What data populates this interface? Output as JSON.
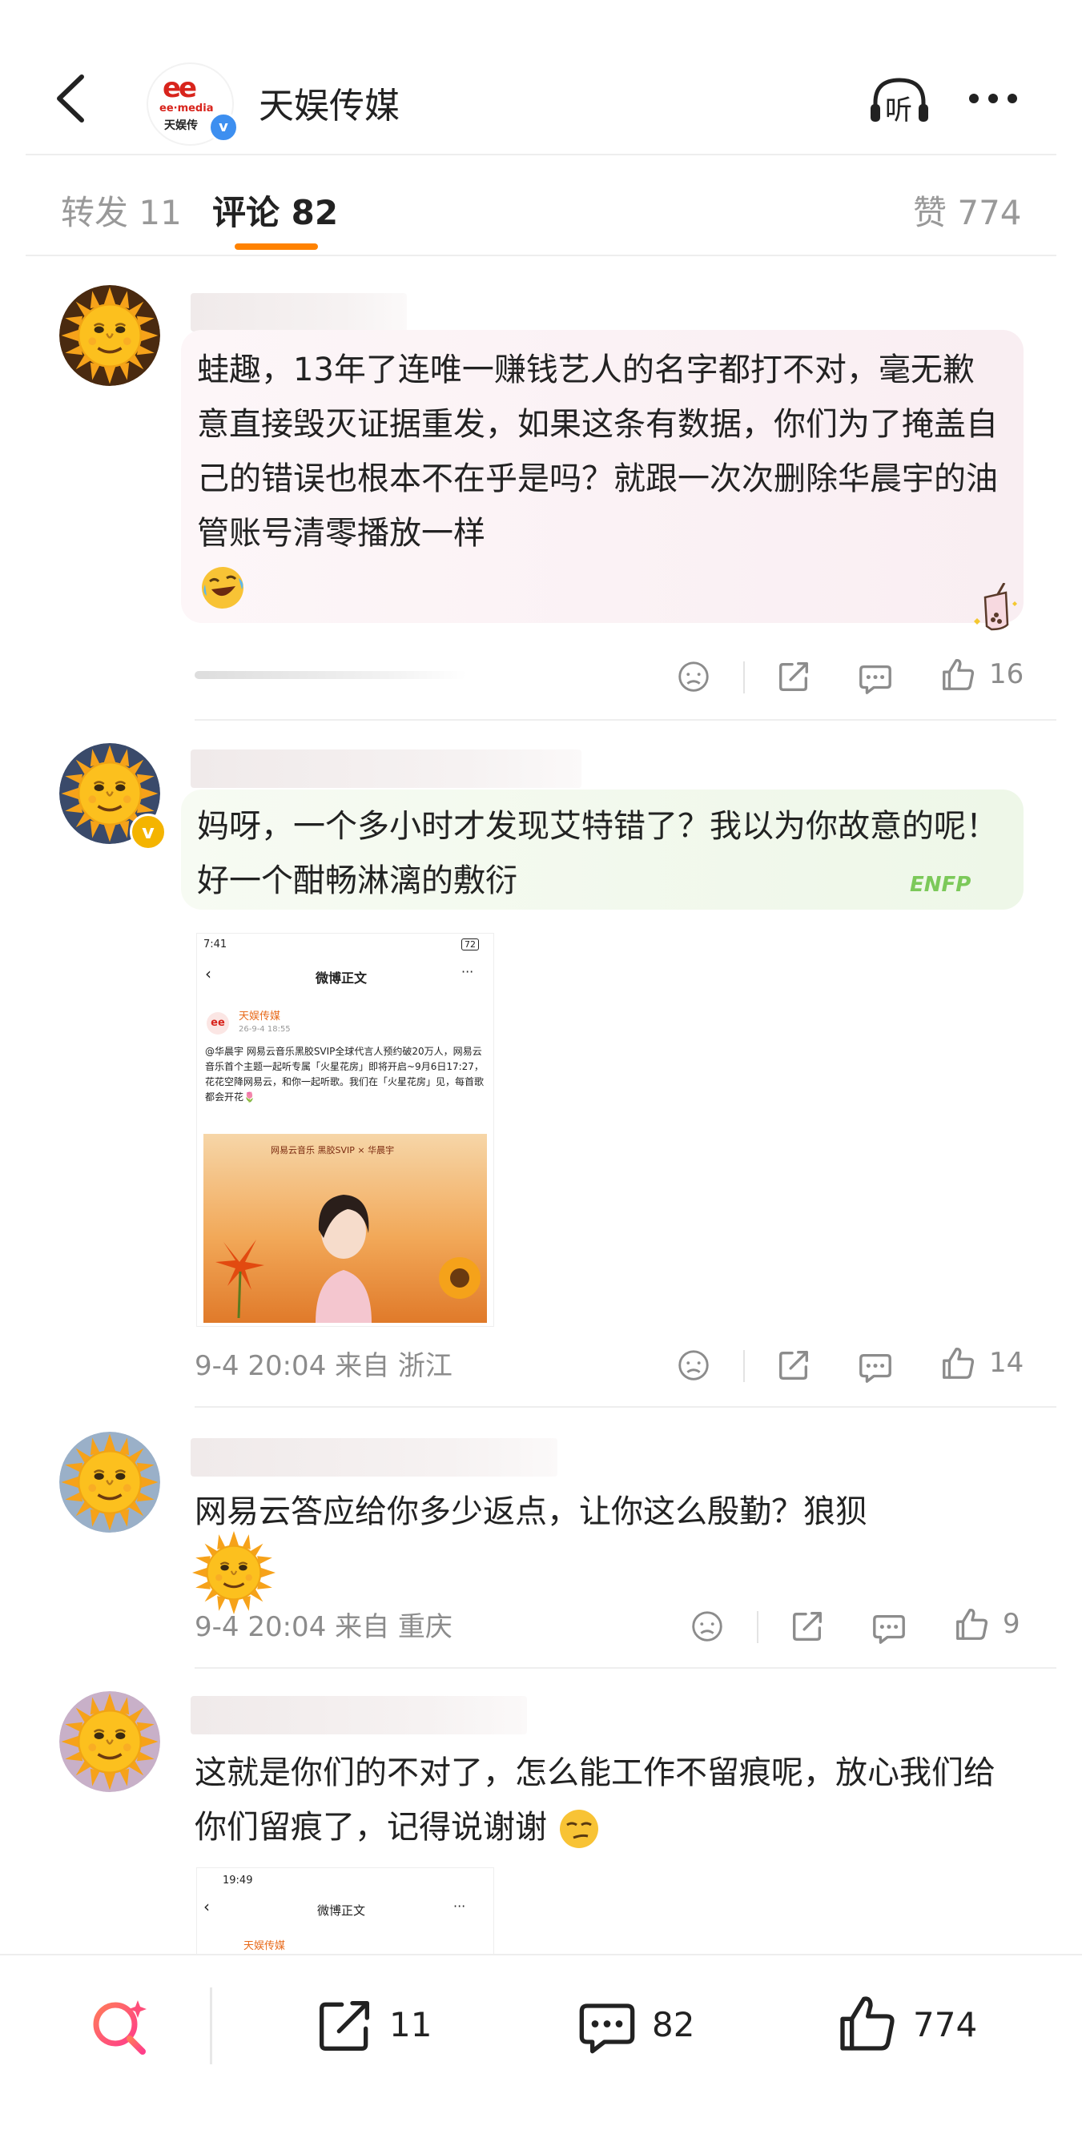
{
  "header": {
    "account_name": "天娱传媒",
    "logo_text": "ee",
    "logo_sub": "ee·media",
    "logo_cn": "天娱传",
    "listen_label": "听",
    "verified_mark": "v"
  },
  "tabs": {
    "repost": "转发 11",
    "comments": "评论 82",
    "likes": "赞 774"
  },
  "comments": [
    {
      "text": "蛙趣，13年了连唯一赚钱艺人的名字都打不对，毫无歉意直接毁灭证据重发，如果这条有数据，你们为了掩盖自己的错误也根本不在乎是吗？就跟一次次删除华晨宇的油管账号清零播放一样",
      "meta": "",
      "likes": "16"
    },
    {
      "text": "妈呀，一个多小时才发现艾特错了？我以为你故意的呢！好一个酣畅淋漓的敷衍",
      "meta": "9-4 20:04  来自 浙江",
      "likes": "14",
      "bubble_tag": "ENFP",
      "shot": {
        "time": "7:41",
        "battery": "72",
        "title": "微博正文",
        "account": "天娱传媒",
        "date": "26-9-4 18:55",
        "body": "@华晨宇 网易云音乐黑胶SVIP全球代言人预约破20万人，网易云音乐首个主题一起听专属「火星花房」即将开启~9月6日17:27，花花空降网易云，和你一起听歌。我们在「火星花房」见，每首歌都会开花🌷",
        "banner": "网易云音乐  黑胶SVIP × 华晨宇"
      }
    },
    {
      "text": "网易云答应给你多少返点，让你这么殷勤？狼狈",
      "meta": "9-4 20:04  来自 重庆",
      "likes": "9"
    },
    {
      "text": "这就是你们的不对了，怎么能工作不留痕呢，放心我们给你们留痕了，记得说谢谢",
      "meta": "",
      "likes": "",
      "shot": {
        "time": "19:49",
        "title": "微博正文",
        "account": "天娱传媒"
      }
    }
  ],
  "bottom_bar": {
    "repost_count": "11",
    "comment_count": "82",
    "like_count": "774"
  },
  "colors": {
    "accent": "#ff8200",
    "text": "#222222",
    "meta": "#8c8c8c",
    "verified": "#3d8ff0",
    "logo_red": "#d8241c"
  },
  "icons": [
    "back-arrow-icon",
    "listen-icon",
    "more-icon",
    "unlike-icon",
    "repost-icon",
    "comment-icon",
    "like-icon",
    "search-spark-icon"
  ]
}
